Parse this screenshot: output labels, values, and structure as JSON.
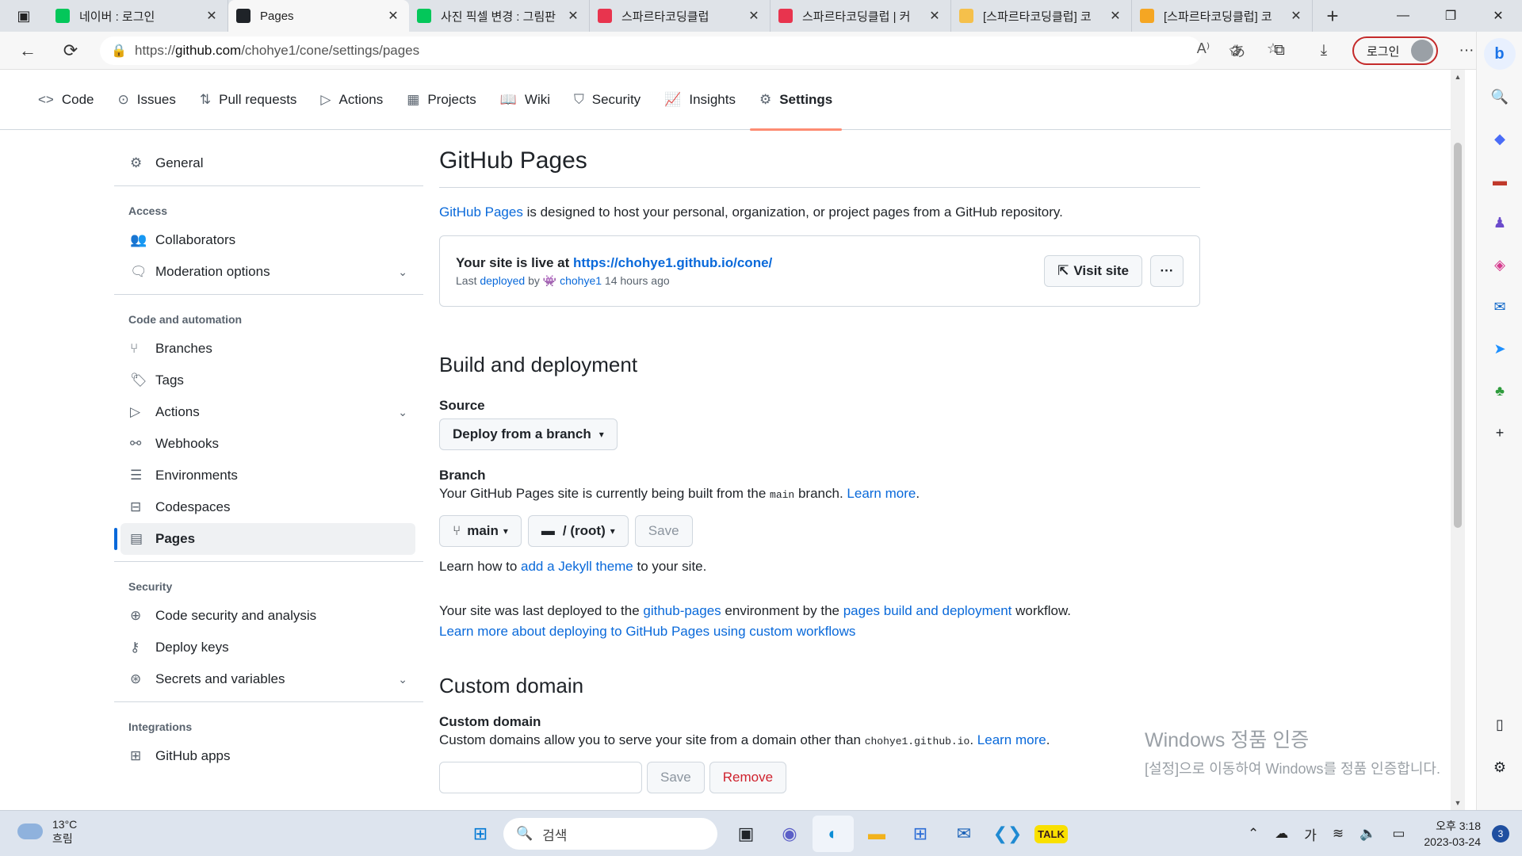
{
  "browser": {
    "tabs": [
      {
        "title": "네이버 : 로그인",
        "favicon": "naver-icon",
        "color": "#03c75a"
      },
      {
        "title": "Pages",
        "favicon": "github-icon",
        "color": "#1f2328"
      },
      {
        "title": "사진 픽셀 변경 : 그림판",
        "favicon": "blog-icon",
        "color": "#03c75a"
      },
      {
        "title": "스파르타코딩클럽",
        "favicon": "sparta-icon",
        "color": "#e8344e"
      },
      {
        "title": "스파르타코딩클럽 | 커",
        "favicon": "sparta-icon",
        "color": "#e8344e"
      },
      {
        "title": "[스파르타코딩클럽] 코",
        "favicon": "star-icon",
        "color": "#f5c04b"
      },
      {
        "title": "[스파르타코딩클럽] 코",
        "favicon": "star-icon",
        "color": "#f5a623"
      }
    ],
    "url_prefix": "https://",
    "url_host": "github.com",
    "url_path": "/chohye1/cone/settings/pages",
    "login_label": "로그인"
  },
  "repo_nav": {
    "tabs": [
      {
        "label": "Code",
        "icon": "code-icon"
      },
      {
        "label": "Issues",
        "icon": "issue-icon"
      },
      {
        "label": "Pull requests",
        "icon": "pull-request-icon"
      },
      {
        "label": "Actions",
        "icon": "play-icon"
      },
      {
        "label": "Projects",
        "icon": "table-icon"
      },
      {
        "label": "Wiki",
        "icon": "book-icon"
      },
      {
        "label": "Security",
        "icon": "shield-icon"
      },
      {
        "label": "Insights",
        "icon": "graph-icon"
      },
      {
        "label": "Settings",
        "icon": "gear-icon"
      }
    ],
    "selected": "Settings"
  },
  "sidebar": {
    "general": "General",
    "groups": {
      "access": "Access",
      "code_automation": "Code and automation",
      "security": "Security",
      "integrations": "Integrations"
    },
    "access_items": [
      "Collaborators",
      "Moderation options"
    ],
    "code_items": [
      "Branches",
      "Tags",
      "Actions",
      "Webhooks",
      "Environments",
      "Codespaces",
      "Pages"
    ],
    "security_items": [
      "Code security and analysis",
      "Deploy keys",
      "Secrets and variables"
    ],
    "integration_items": [
      "GitHub apps"
    ]
  },
  "main": {
    "title": "GitHub Pages",
    "intro_link": "GitHub Pages",
    "intro_text": " is designed to host your personal, organization, or project pages from a GitHub repository.",
    "live": {
      "prefix": "Your site is live at ",
      "url": "https://chohye1.github.io/cone/",
      "last": "Last ",
      "deployed": "deployed",
      "by": " by ",
      "user": "chohye1",
      "time": " 14 hours ago",
      "visit": "Visit site",
      "more": "···"
    },
    "build_title": "Build and deployment",
    "source_label": "Source",
    "source_value": "Deploy from a branch",
    "branch_label": "Branch",
    "branch_text_1": "Your GitHub Pages site is currently being built from the ",
    "branch_code": "main",
    "branch_text_2": " branch. ",
    "learn_more": "Learn more",
    "branch_select": "main",
    "folder_select": "/ (root)",
    "save": "Save",
    "jekyll_1": "Learn how to ",
    "jekyll_link": "add a Jekyll theme",
    "jekyll_2": " to your site.",
    "deploy_1": "Your site was last deployed to the ",
    "deploy_env": "github-pages",
    "deploy_2": " environment by the ",
    "deploy_wf": "pages build and deployment",
    "deploy_3": " workflow.",
    "custom_wf_link": "Learn more about deploying to GitHub Pages using custom workflows",
    "custom_title": "Custom domain",
    "custom_label": "Custom domain",
    "custom_text_1": "Custom domains allow you to serve your site from a domain other than ",
    "custom_code": "chohye1.github.io",
    "custom_text_2": ". ",
    "remove": "Remove"
  },
  "watermark": {
    "line1": "Windows 정품 인증",
    "line2": "[설정]으로 이동하여 Windows를 정품 인증합니다."
  },
  "taskbar": {
    "temp": "13°C",
    "cond": "흐림",
    "search": "검색",
    "time": "오후 3:18",
    "date": "2023-03-24",
    "ime": "가",
    "notif": "3"
  }
}
